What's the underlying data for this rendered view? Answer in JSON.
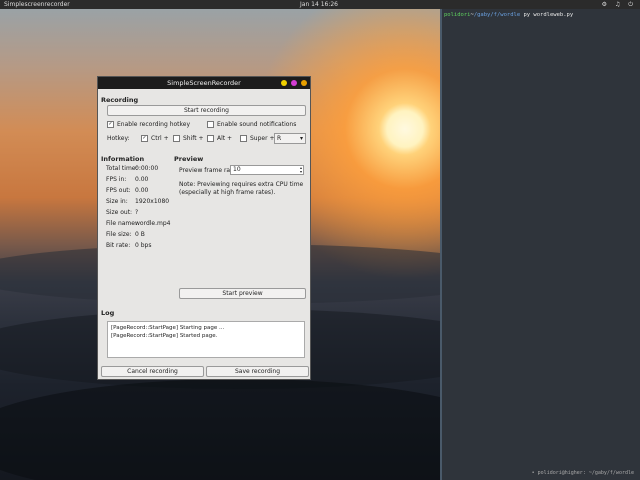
{
  "panel": {
    "app_name": "Simplescreenrecorder",
    "clock": "Jan 14  16:26",
    "tray": "⚙ ♫ ⏻"
  },
  "terminal": {
    "prompt_user": "polidori",
    "prompt_sep": "~",
    "prompt_path": "/gaby/f/wordle",
    "command": " py wordleweb.py",
    "status": "• polidori@higher: ~/gaby/f/wordle"
  },
  "window": {
    "title": "SimpleScreenRecorder",
    "recording": {
      "header": "Recording",
      "start_label": "Start recording",
      "hotkey_enable_label": "Enable recording hotkey",
      "sound_label": "Enable sound notifications",
      "hotkey_label": "Hotkey:",
      "ctrl_label": "Ctrl +",
      "shift_label": "Shift +",
      "alt_label": "Alt +",
      "super_label": "Super +",
      "key_value": "R",
      "dropdown_arrow": "▾"
    },
    "information": {
      "header": "Information",
      "rows": [
        {
          "label": "Total time:",
          "value": "0:00:00"
        },
        {
          "label": "FPS in:",
          "value": "0.00"
        },
        {
          "label": "FPS out:",
          "value": "0.00"
        },
        {
          "label": "Size in:",
          "value": "1920x1080"
        },
        {
          "label": "Size out:",
          "value": "?"
        },
        {
          "label": "File name:",
          "value": "wordle.mp4"
        },
        {
          "label": "File size:",
          "value": "0 B"
        },
        {
          "label": "Bit rate:",
          "value": "0 bps"
        }
      ]
    },
    "preview": {
      "header": "Preview",
      "rate_label": "Preview frame rate:",
      "rate_value": "10",
      "note": "Note: Previewing requires extra CPU time (especially at high frame rates).",
      "start_label": "Start preview"
    },
    "log": {
      "header": "Log",
      "lines": [
        "[PageRecord::StartPage] Starting page ...",
        "[PageRecord::StartPage] Started page."
      ]
    },
    "cancel_label": "Cancel recording",
    "save_label": "Save recording"
  },
  "colors": {
    "close": "#e8a000",
    "min": "#d33cd3",
    "max": "#f0d000"
  }
}
